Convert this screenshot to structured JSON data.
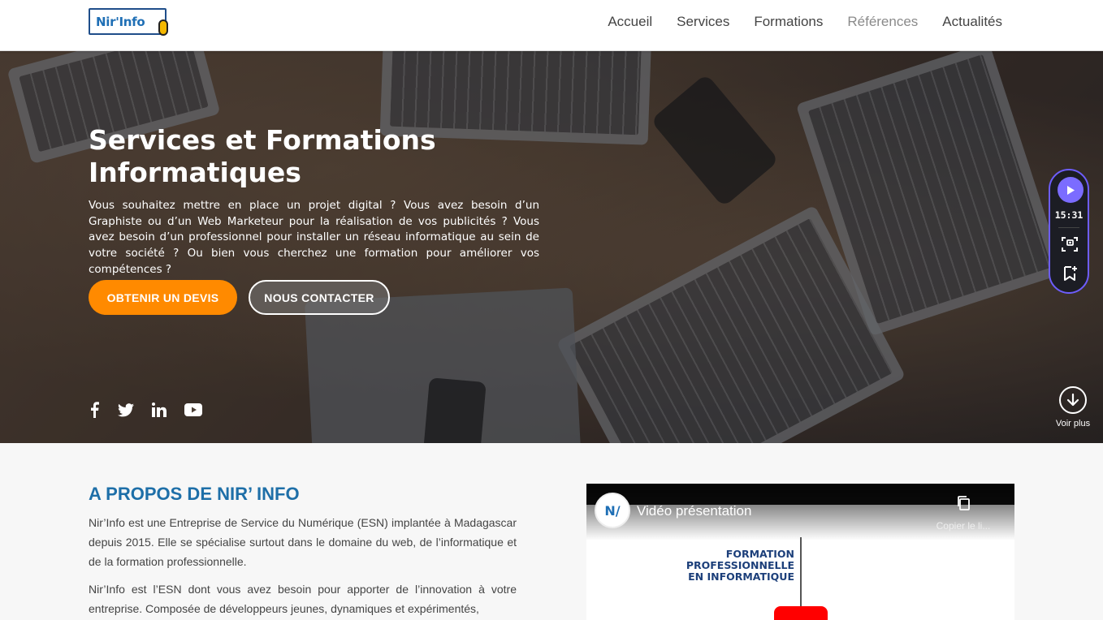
{
  "header": {
    "logo_text": "Nir'Info",
    "nav": [
      "Accueil",
      "Services",
      "Formations",
      "Références",
      "Actualités"
    ]
  },
  "hero": {
    "title": "Services et Formations Informatiques",
    "text": "Vous souhaitez mettre en place un projet digital ? Vous avez besoin d’un Graphiste ou d’un Web Marketeur pour la réalisation de vos publicités ? Vous avez besoin d’un professionnel pour installer un réseau informatique au sein de votre société ? Ou bien vous cherchez une formation pour améliorer vos compétences ?",
    "btn_devis": "OBTENIR UN DEVIS",
    "btn_contact": "NOUS CONTACTER",
    "socials": [
      "facebook-icon",
      "twitter-icon",
      "linkedin-icon",
      "youtube-icon"
    ],
    "voir_plus": "Voir plus"
  },
  "widget": {
    "time": "15:31"
  },
  "about": {
    "title": "A PROPOS DE NIR’ INFO",
    "p1": "Nir’Info est une Entreprise de Service du Numérique (ESN) implantée à Madagascar depuis 2015. Elle se spécialise surtout dans le domaine du web, de l’informatique et de la formation professionnelle.",
    "p2": "Nir’Info est l’ESN dont vous avez besoin pour apporter de l’innovation à votre entreprise. Composée de développeurs jeunes, dynamiques et expérimentés,"
  },
  "video": {
    "title": "Vidéo présentation",
    "copy_label": "Copier le li...",
    "body_line1": "FORMATION PROFESSIONNELLE",
    "body_line2": "EN INFORMATIQUE",
    "avatar_text": "N/"
  },
  "colors": {
    "accent_orange": "#ff8a00",
    "title_blue": "#1e6fa8",
    "widget_purple": "#7b6cff"
  }
}
